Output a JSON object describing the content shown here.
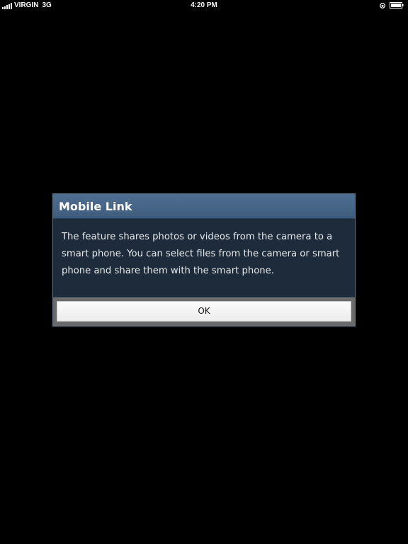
{
  "status_bar": {
    "carrier": "VIRGIN",
    "network": "3G",
    "time": "4:20 PM",
    "icons": [
      "signal-strength-icon",
      "orientation-lock-icon",
      "battery-icon"
    ]
  },
  "dialog": {
    "title": "Mobile Link",
    "message": "The feature shares photos or videos from the camera to a smart phone. You can select files from the camera or smart phone and share them with the smart phone.",
    "ok_label": "OK"
  },
  "colors": {
    "background": "#000000",
    "dialog_header": "#46658a",
    "dialog_body": "#1d2b3a",
    "dialog_footer": "#6b6b6b",
    "button": "#f4f4f4",
    "text_light": "#ffffff"
  }
}
